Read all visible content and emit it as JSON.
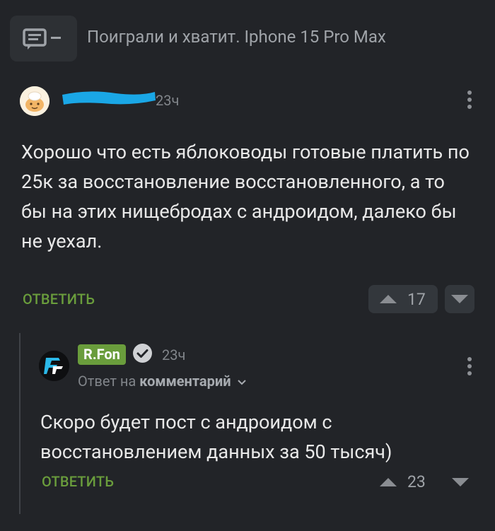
{
  "post": {
    "title": "Поиграли и хватит. Iphone 15 Pro Max",
    "icon": "comments-collapse-icon"
  },
  "comment1": {
    "author_hidden": true,
    "time": "23ч",
    "text": "Хорошо что есть яблоководы готовые платить по 25к за восстановление восстановленного, а то бы на этих нищебродах с андроидом, далеко бы не уехал.",
    "reply_label": "ОТВЕТИТЬ",
    "rating": "17"
  },
  "comment2": {
    "author": "R.Fon",
    "time": "23ч",
    "reply_prefix": "Ответ на",
    "reply_target": "комментарий",
    "text": "Скоро будет пост с андроидом с восстановлением данных за 50 тысяч)",
    "reply_label": "ОТВЕТИТЬ",
    "rating": "23"
  },
  "colors": {
    "background": "#222428",
    "accent_green": "#6a9d3c",
    "muted_text": "#81858a",
    "scribble": "#1aa7e6"
  }
}
